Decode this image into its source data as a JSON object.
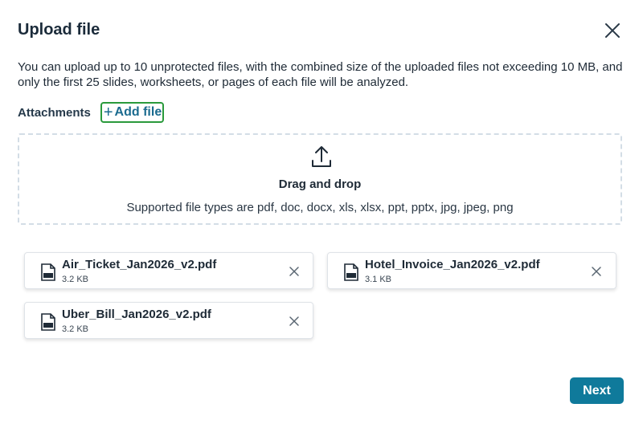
{
  "dialog": {
    "title": "Upload file",
    "description": "You can upload up to 10 unprotected files, with the combined size of the uploaded files not exceeding 10 MB, and only the first 25 slides, worksheets, or pages of each file will be analyzed.",
    "close_icon": "close-icon"
  },
  "attachments": {
    "label": "Attachments",
    "add_file_label": "Add file",
    "add_icon": "plus-icon"
  },
  "dropzone": {
    "icon": "upload-icon",
    "title": "Drag and drop",
    "supported": "Supported file types are pdf, doc, docx, xls, xlsx, ppt, pptx, jpg, jpeg, png"
  },
  "files": [
    {
      "name": "Air_Ticket_Jan2026_v2.pdf",
      "size": "3.2 KB",
      "icon": "pdf-file-icon"
    },
    {
      "name": "Hotel_Invoice_Jan2026_v2.pdf",
      "size": "3.1 KB",
      "icon": "pdf-file-icon"
    },
    {
      "name": "Uber_Bill_Jan2026_v2.pdf",
      "size": "3.2 KB",
      "icon": "pdf-file-icon"
    }
  ],
  "footer": {
    "next_label": "Next"
  },
  "colors": {
    "primary": "#0f7a9b",
    "focus_outline": "#2a9a3c",
    "link": "#1b6b8f"
  }
}
